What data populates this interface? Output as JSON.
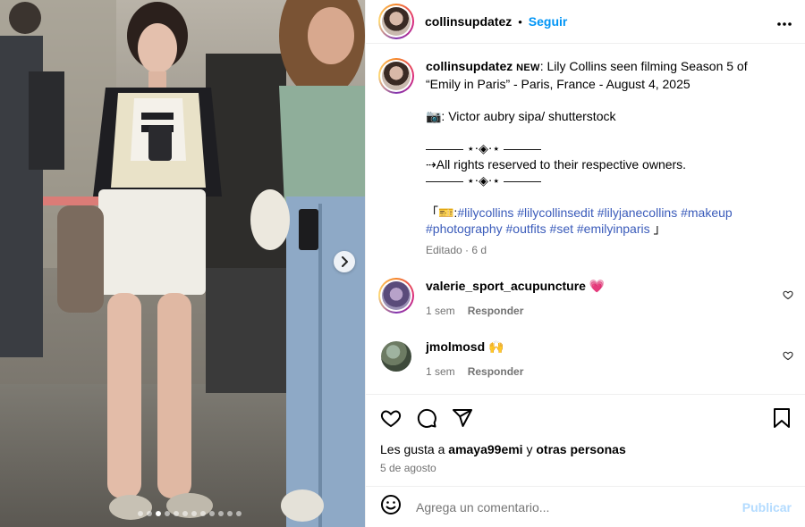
{
  "post": {
    "username": "collinsupdatez",
    "separator": "•",
    "follow_label": "Seguir",
    "more_label": "•••"
  },
  "caption": {
    "username": "collinsupdatez",
    "badge": "NEW",
    "line1": ": Lily Collins seen filming Season 5 of “Emily in Paris” - Paris, France - August 4, 2025",
    "credit": "📷: Victor aubry sipa/ shutterstock",
    "divider1": "——— ⋆⋅◈⋅⋆ ———",
    "rights": "⇢All rights reserved to their respective owners.",
    "divider2": "——— ⋆⋅◈⋅⋆ ———",
    "tag_open": "「🎫:",
    "tags": "#lilycollins #lilycollinsedit #lilyjanecollins #makeup #photography #outfits #set #emilyinparis",
    "tag_close": " 」",
    "edited": "Editado · 6 d"
  },
  "comments": [
    {
      "username": "valerie_sport_acupuncture",
      "text": "💗",
      "time": "1 sem",
      "reply": "Responder"
    },
    {
      "username": "jmolmosd",
      "text": "🙌",
      "time": "1 sem",
      "reply": "Responder"
    }
  ],
  "likes": {
    "prefix": "Les gusta a ",
    "user": "amaya99emi",
    "middle": " y ",
    "others": "otras personas"
  },
  "date": "5 de agosto",
  "add_comment": {
    "placeholder": "Agrega un comentario...",
    "post_label": "Publicar"
  },
  "carousel": {
    "total": 12,
    "active_index": 2
  },
  "icons": [
    "heart-icon",
    "comment-icon",
    "share-icon",
    "bookmark-icon",
    "emoji-icon",
    "chevron-right-icon",
    "more-icon"
  ],
  "colors": {
    "link": "#0095f6",
    "tag": "#3a5bba",
    "muted": "#737373",
    "post_disabled": "#b3dbff",
    "heart_emoji": "#e8457a"
  }
}
